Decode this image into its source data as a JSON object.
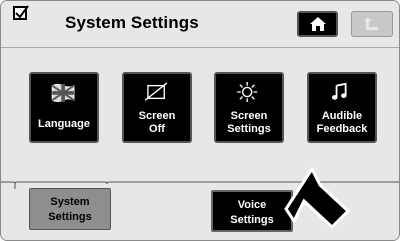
{
  "header": {
    "title": "System Settings",
    "check_icon": "checkbox-check-icon",
    "home_icon": "home-icon",
    "back_icon": "back-arrow-icon"
  },
  "tiles": [
    {
      "label": "Language",
      "icon": "flag-icon"
    },
    {
      "label": "Screen\nOff",
      "icon": "screen-off-icon"
    },
    {
      "label": "Screen\nSettings",
      "icon": "sun-icon"
    },
    {
      "label": "Audible\nFeedback",
      "icon": "music-note-icon"
    }
  ],
  "bottom": {
    "system_settings": "System\nSettings",
    "voice_settings": "Voice\nSettings"
  },
  "pointer": "arrow-pointer-icon",
  "colors": {
    "background": "#e7e7e7",
    "button_dark": "#000000",
    "button_selected": "#8e8e8e"
  }
}
